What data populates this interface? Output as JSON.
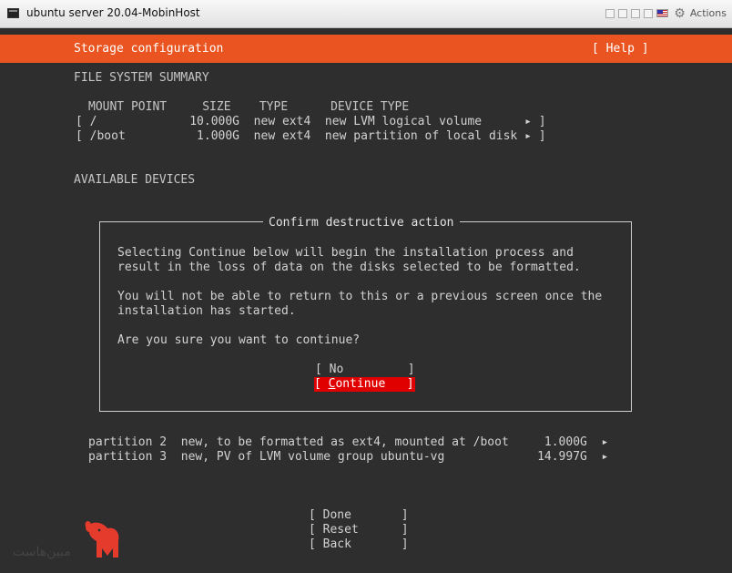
{
  "window": {
    "title": "ubuntu server 20.04-MobinHost",
    "actions_label": "Actions"
  },
  "header": {
    "title": "Storage configuration",
    "help": "[ Help ]"
  },
  "fs_summary": {
    "heading": "FILE SYSTEM SUMMARY",
    "columns_line": "MOUNT POINT     SIZE    TYPE      DEVICE TYPE",
    "rows": [
      "[ /             10.000G  new ext4  new LVM logical volume      ▸ ]",
      "[ /boot          1.000G  new ext4  new partition of local disk ▸ ]"
    ]
  },
  "available_devices": {
    "heading": "AVAILABLE DEVICES",
    "partitions": [
      "partition 2  new, to be formatted as ext4, mounted at /boot     1.000G  ▸",
      "partition 3  new, PV of LVM volume group ubuntu-vg             14.997G  ▸"
    ]
  },
  "dialog": {
    "title": "Confirm destructive action",
    "line1": "Selecting Continue below will begin the installation process and",
    "line2": "result in the loss of data on the disks selected to be formatted.",
    "line3": "You will not be able to return to this or a previous screen once the",
    "line4": "installation has started.",
    "line5": "Are you sure you want to continue?",
    "no_button": "[ No         ]",
    "continue_open": "[ ",
    "continue_hot": "C",
    "continue_rest": "ontinue   ]"
  },
  "footer": {
    "done": "[ Done       ]",
    "reset": "[ Reset      ]",
    "back": "[ Back       ]"
  },
  "logo": {
    "text": "مبین‌هاست"
  },
  "colors": {
    "accent": "#e95420",
    "selected_button": "#e00000",
    "terminal_bg": "#2e2e2e"
  }
}
